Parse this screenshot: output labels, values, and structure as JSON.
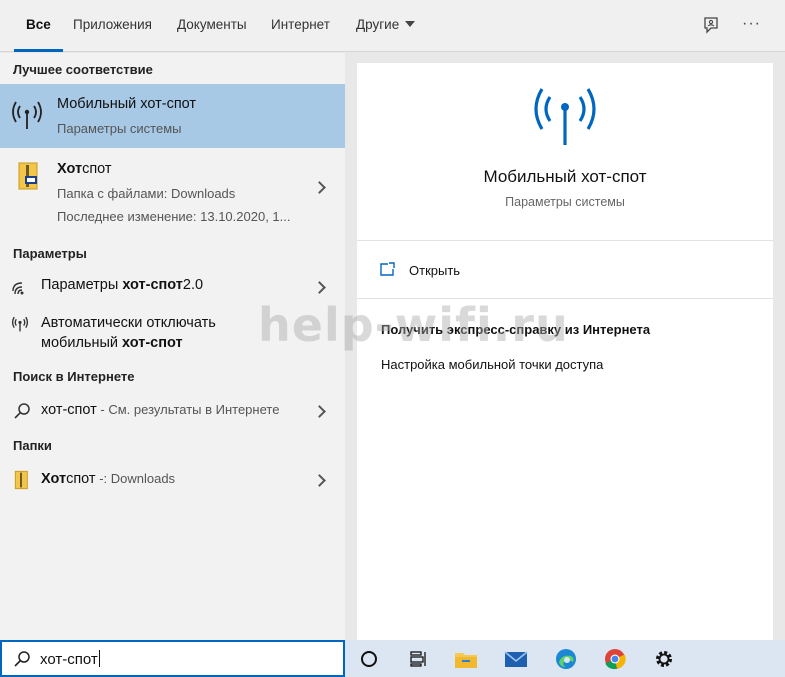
{
  "tabs": [
    {
      "label": "Все",
      "active": true
    },
    {
      "label": "Приложения"
    },
    {
      "label": "Документы"
    },
    {
      "label": "Интернет"
    },
    {
      "label": "Другие"
    }
  ],
  "top_icons": [
    "feedback-icon",
    "more-icon"
  ],
  "more_label": "···",
  "sections": {
    "best_match": "Лучшее соответствие",
    "settings": "Параметры",
    "web": "Поиск в Интернете",
    "folders": "Папки"
  },
  "best_match": {
    "title": "Мобильный хот-спот",
    "subtitle": "Параметры системы"
  },
  "folder_result": {
    "title_bold": "Хот",
    "title_rest": "спот",
    "line1": "Папка с файлами: Downloads",
    "line2": "Последнее изменение: 13.10.2020, 1..."
  },
  "settings_results": [
    {
      "pre": "Параметры ",
      "bold": "хот-спот",
      "post": "2.0"
    },
    {
      "line1": "Автоматически отключать",
      "line2_pre": "мобильный ",
      "line2_bold": "хот-спот"
    }
  ],
  "web_result": {
    "query": "хот-спот",
    "suffix": " - См. результаты в Интернете"
  },
  "folders_result": {
    "bold": "Хот",
    "rest": "спот",
    "suffix": " -: Downloads"
  },
  "detail": {
    "title": "Мобильный хот-спот",
    "subtitle": "Параметры системы",
    "open_label": "Открыть",
    "help_heading": "Получить экспресс-справку из Интернета",
    "help_link": "Настройка мобильной точки доступа"
  },
  "watermark": "help-wifi.ru",
  "search": {
    "value": "хот-спот"
  },
  "taskbar_icons": [
    "cortana-icon",
    "task-view-icon",
    "file-explorer-icon",
    "mail-icon",
    "edge-icon",
    "chrome-icon",
    "settings-icon"
  ],
  "colors": {
    "accent": "#0067c0",
    "selected": "#a7c9e6"
  }
}
